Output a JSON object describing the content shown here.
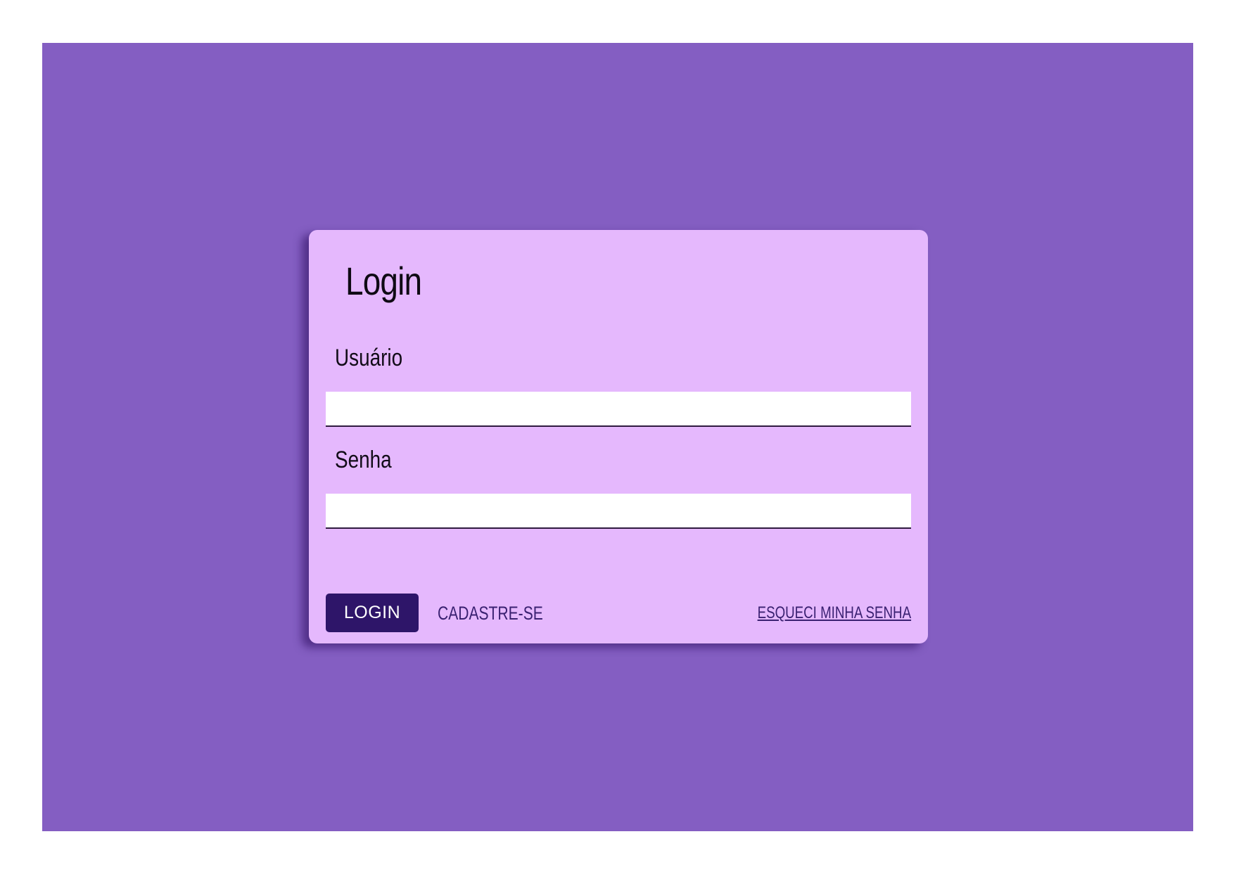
{
  "colors": {
    "page_background": "#ffffff",
    "frame_background": "#845ec2",
    "card_background": "#e5b8fd",
    "button_background": "#2e1569",
    "link_color": "#3a2171"
  },
  "login_card": {
    "title": "Login",
    "username": {
      "label": "Usuário",
      "value": "",
      "placeholder": ""
    },
    "password": {
      "label": "Senha",
      "value": "",
      "placeholder": ""
    },
    "login_button_label": "LOGIN",
    "signup_link_label": "CADASTRE-SE",
    "forgot_password_link_label": "ESQUECI MINHA SENHA"
  }
}
